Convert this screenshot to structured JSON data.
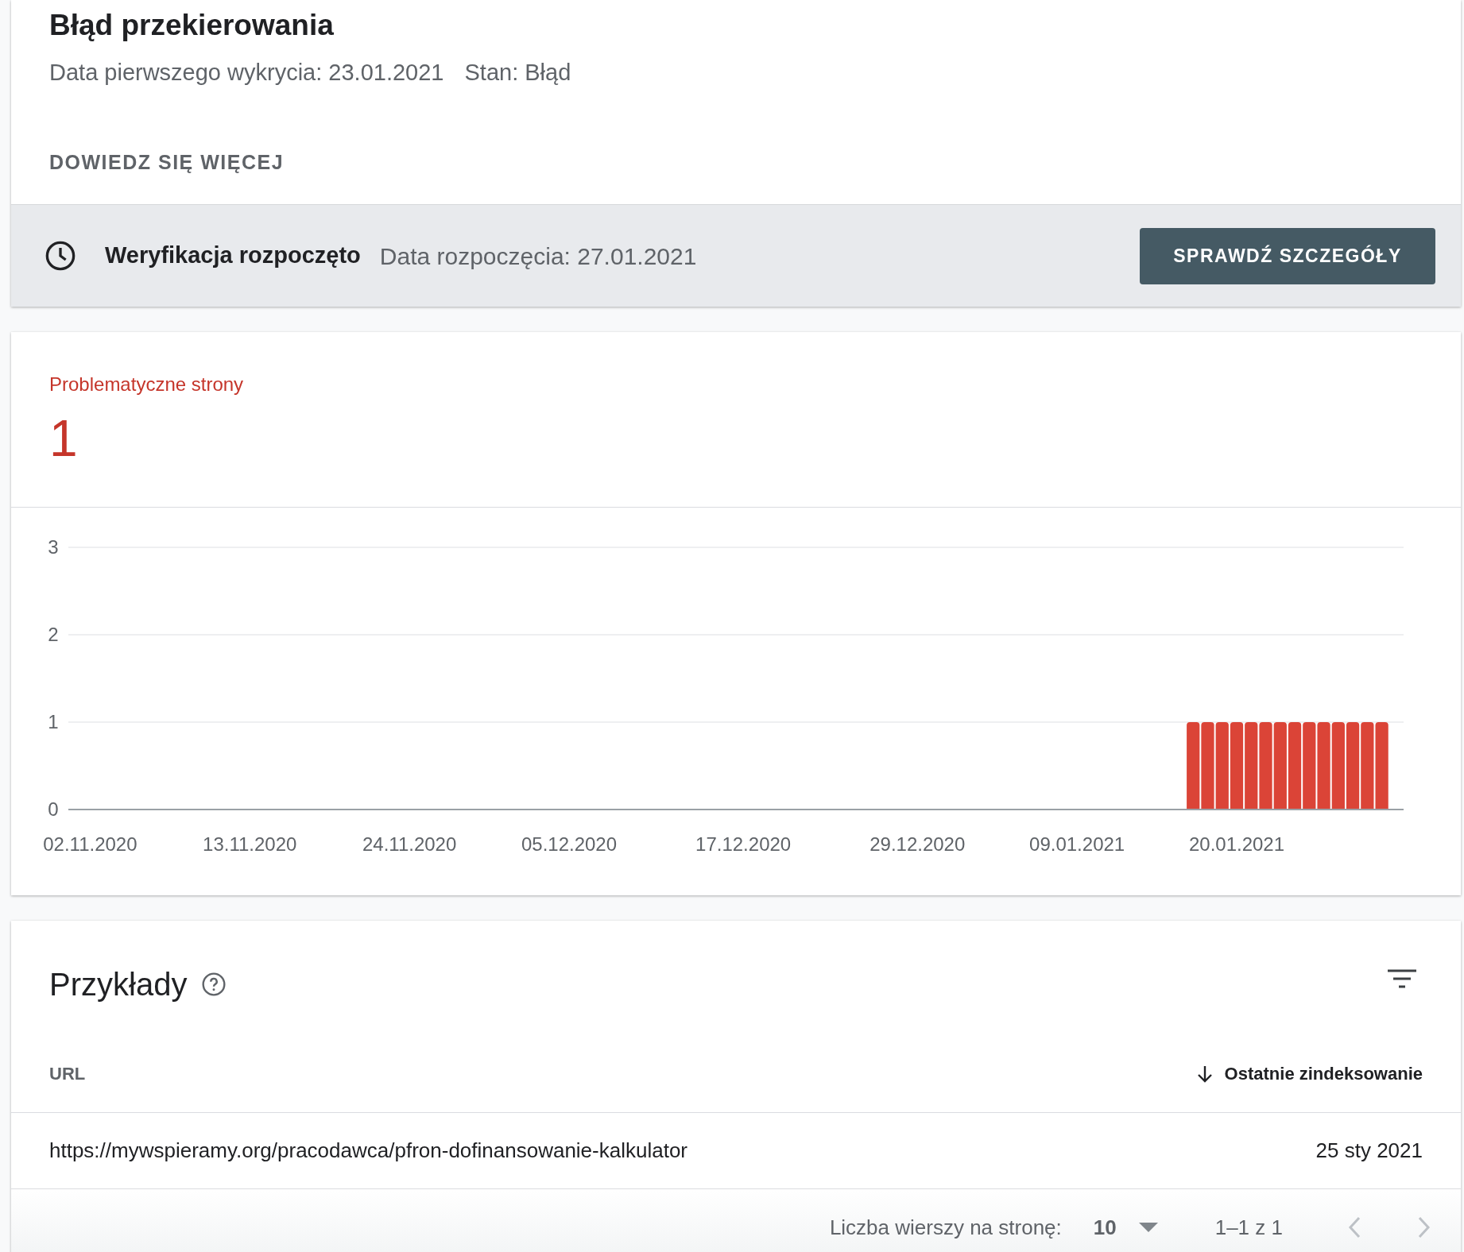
{
  "header": {
    "title": "Błąd przekierowania",
    "first_detected": "Data pierwszego wykrycia: 23.01.2021",
    "state": "Stan: Błąd",
    "learn_more": "DOWIEDZ SIĘ WIĘCEJ"
  },
  "validation": {
    "status": "Weryfikacja rozpoczęto",
    "started": "Data rozpoczęcia: 27.01.2021",
    "button": "SPRAWDŹ SZCZEGÓŁY"
  },
  "summary": {
    "label": "Problematyczne strony",
    "count": "1",
    "color": "#c5352a",
    "chart_data": {
      "type": "bar",
      "series": [
        {
          "color": "#db4437",
          "values": [
            0,
            0,
            0,
            0,
            0,
            0,
            0,
            0,
            0,
            0,
            0,
            0,
            0,
            0,
            0,
            0,
            0,
            0,
            0,
            0,
            0,
            0,
            0,
            0,
            0,
            0,
            0,
            0,
            0,
            0,
            0,
            0,
            0,
            0,
            0,
            0,
            0,
            0,
            0,
            0,
            0,
            0,
            0,
            0,
            0,
            0,
            0,
            0,
            0,
            0,
            0,
            0,
            0,
            0,
            0,
            0,
            0,
            0,
            0,
            0,
            0,
            0,
            0,
            0,
            0,
            0,
            0,
            0,
            0,
            0,
            0,
            0,
            0,
            0,
            0,
            0,
            0,
            1,
            1,
            1,
            1,
            1,
            1,
            1,
            1,
            1,
            1,
            1,
            1,
            1,
            1,
            0
          ]
        }
      ],
      "categories": [
        null,
        "02.11.2020",
        null,
        null,
        null,
        null,
        null,
        null,
        null,
        null,
        null,
        null,
        "13.11.2020",
        null,
        null,
        null,
        null,
        null,
        null,
        null,
        null,
        null,
        null,
        "24.11.2020",
        null,
        null,
        null,
        null,
        null,
        null,
        null,
        null,
        null,
        null,
        "05.12.2020",
        null,
        null,
        null,
        null,
        null,
        null,
        null,
        null,
        null,
        null,
        null,
        "17.12.2020",
        null,
        null,
        null,
        null,
        null,
        null,
        null,
        null,
        null,
        null,
        null,
        "29.12.2020",
        null,
        null,
        null,
        null,
        null,
        null,
        null,
        null,
        null,
        null,
        "09.01.2021",
        null,
        null,
        null,
        null,
        null,
        null,
        null,
        null,
        null,
        null,
        "20.01.2021",
        null,
        null,
        null,
        null,
        null,
        null,
        null,
        null,
        null,
        null,
        null
      ],
      "ylim": [
        0,
        3
      ],
      "yticks": [
        0,
        1,
        2,
        3
      ]
    }
  },
  "examples": {
    "title": "Przykłady",
    "columns": [
      {
        "label": "URL",
        "sorted": false
      },
      {
        "label": "Ostatnie zindeksowanie",
        "sorted": true
      }
    ],
    "rows": [
      {
        "url": "https://mywspieramy.org/pracodawca/pfron-dofinansowanie-kalkulator",
        "last_indexed": "25 sty 2021"
      }
    ],
    "pagination": {
      "rows_label": "Liczba wierszy na stronę:",
      "rows_per_page": "10",
      "range": "1–1 z 1"
    }
  }
}
